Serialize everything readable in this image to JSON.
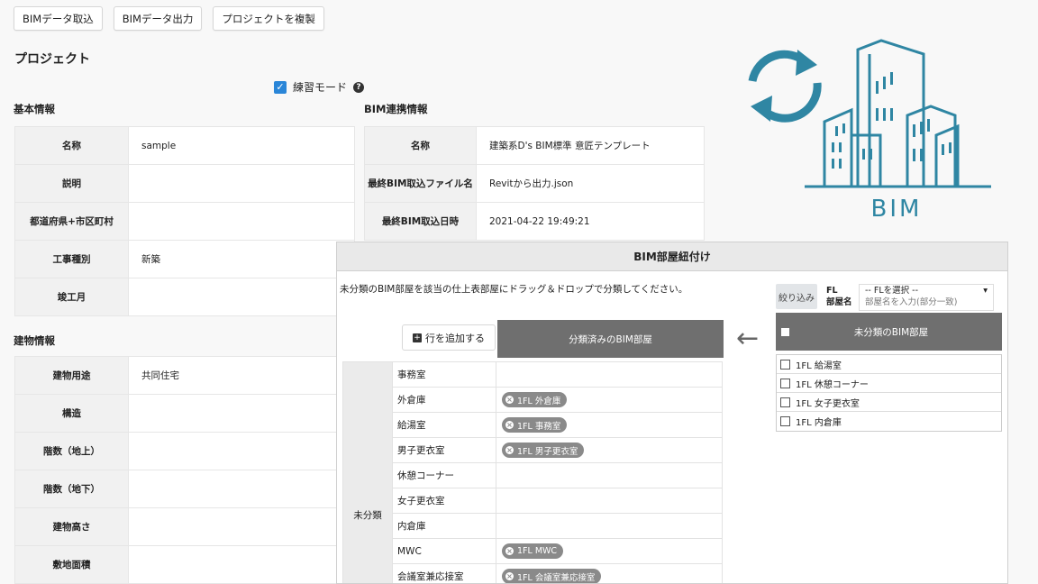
{
  "toolbar": {
    "import_label": "BIMデータ取込",
    "export_label": "BIMデータ出力",
    "duplicate_label": "プロジェクトを複製"
  },
  "page_title": "プロジェクト",
  "practice_mode": {
    "label": "練習モード",
    "checked": true
  },
  "basic_info": {
    "title": "基本情報",
    "rows": [
      {
        "label": "名称",
        "value": "sample"
      },
      {
        "label": "説明",
        "value": ""
      },
      {
        "label": "都道府県+市区町村",
        "value": ""
      },
      {
        "label": "工事種別",
        "value": "新築"
      },
      {
        "label": "竣工月",
        "value": ""
      }
    ]
  },
  "bim_info": {
    "title": "BIM連携情報",
    "rows": [
      {
        "label": "名称",
        "value": "建築系D's BIM標準 意匠テンプレート"
      },
      {
        "label": "最終BIM取込ファイル名",
        "value": "Revitから出力.json"
      },
      {
        "label": "最終BIM取込日時",
        "value": "2021-04-22 19:49:21"
      }
    ]
  },
  "building_info": {
    "title": "建物情報",
    "rows": [
      {
        "label": "建物用途",
        "value": "共同住宅"
      },
      {
        "label": "構造",
        "value": ""
      },
      {
        "label": "階数（地上）",
        "value": ""
      },
      {
        "label": "階数（地下）",
        "value": ""
      },
      {
        "label": "建物高さ",
        "value": ""
      },
      {
        "label": "敷地面積",
        "value": ""
      }
    ]
  },
  "logo": {
    "text": "BIM",
    "color": "#2f86a3"
  },
  "dialog": {
    "title": "BIM部屋紐付け",
    "instruction": "未分類のBIM部屋を該当の仕上表部屋にドラッグ＆ドロップで分類してください。",
    "filter": {
      "button": "絞り込み",
      "fl_label": "FL",
      "room_label": "部屋名",
      "fl_placeholder": "-- FLを選択 --",
      "room_placeholder": "部屋名を入力(部分一致)"
    },
    "add_row_label": "行を追加する",
    "classified_header": "分類済みのBIM部屋",
    "unclassified_header": "未分類のBIM部屋",
    "unclassified_items": [
      "1FL 給湯室",
      "1FL 休憩コーナー",
      "1FL 女子更衣室",
      "1FL 内倉庫"
    ],
    "group_label": "未分類",
    "rooms": [
      {
        "name": "事務室",
        "tag": ""
      },
      {
        "name": "外倉庫",
        "tag": "1FL 外倉庫"
      },
      {
        "name": "給湯室",
        "tag": "1FL 事務室"
      },
      {
        "name": "男子更衣室",
        "tag": "1FL 男子更衣室"
      },
      {
        "name": "休憩コーナー",
        "tag": ""
      },
      {
        "name": "女子更衣室",
        "tag": ""
      },
      {
        "name": "内倉庫",
        "tag": ""
      },
      {
        "name": "MWC",
        "tag": "1FL MWC"
      },
      {
        "name": "会議室兼応接室",
        "tag": "1FL 会議室兼応接室"
      }
    ]
  }
}
